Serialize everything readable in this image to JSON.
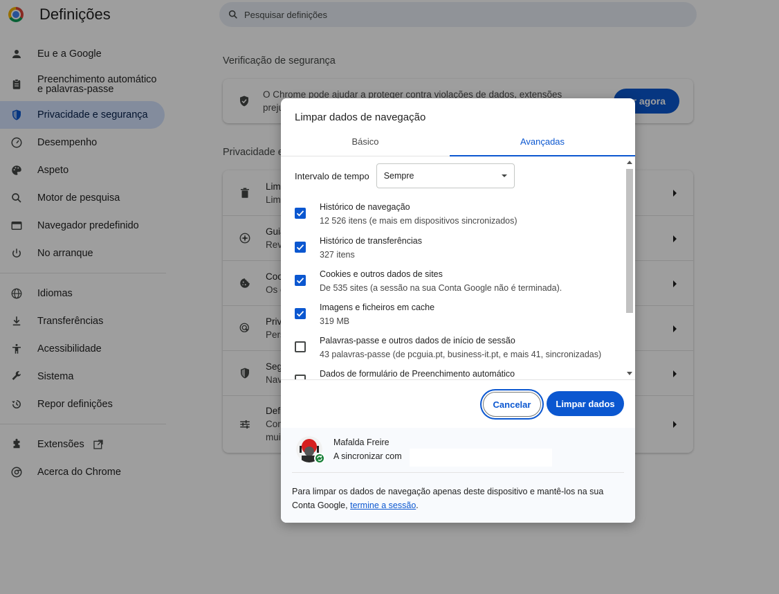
{
  "app": {
    "title": "Definições"
  },
  "search": {
    "placeholder": "Pesquisar definições"
  },
  "sidebar": {
    "items": [
      {
        "label": "Eu e a Google"
      },
      {
        "label": "Preenchimento automático e palavras-passe"
      },
      {
        "label": "Privacidade e segurança"
      },
      {
        "label": "Desempenho"
      },
      {
        "label": "Aspeto"
      },
      {
        "label": "Motor de pesquisa"
      },
      {
        "label": "Navegador predefinido"
      },
      {
        "label": "No arranque"
      },
      {
        "label": "Idiomas"
      },
      {
        "label": "Transferências"
      },
      {
        "label": "Acessibilidade"
      },
      {
        "label": "Sistema"
      },
      {
        "label": "Repor definições"
      },
      {
        "label": "Extensões"
      },
      {
        "label": "Acerca do Chrome"
      }
    ]
  },
  "main": {
    "safety_title": "Verificação de segurança",
    "safety_text": "O Chrome pode ajudar a proteger contra violações de dados, extensões prejudiciais e muit",
    "safety_button": "er agora",
    "privacy_title": "Privacidade e",
    "rows": [
      {
        "t1": "Limp",
        "t2": "Limp"
      },
      {
        "t1": "Guia",
        "t2": "Reve"
      },
      {
        "t1": "Cook",
        "t2": "Os c"
      },
      {
        "t1": "Priva",
        "t2": "Perso"
      },
      {
        "t1": "Segu",
        "t2": "Nave"
      },
      {
        "t1": "Defir",
        "t2": "Cont",
        "t3": "muit"
      }
    ]
  },
  "dialog": {
    "title": "Limpar dados de navegação",
    "tabs": {
      "basic": "Básico",
      "advanced": "Avançadas"
    },
    "time_range": {
      "label": "Intervalo de tempo",
      "value": "Sempre"
    },
    "options": [
      {
        "title": "Histórico de navegação",
        "detail": "12 526 itens (e mais em dispositivos sincronizados)",
        "checked": true
      },
      {
        "title": "Histórico de transferências",
        "detail": "327 itens",
        "checked": true
      },
      {
        "title": "Cookies e outros dados de sites",
        "detail": "De 535 sites (a sessão na sua Conta Google não é terminada).",
        "checked": true
      },
      {
        "title": "Imagens e ficheiros em cache",
        "detail": "319 MB",
        "checked": true
      },
      {
        "title": "Palavras-passe e outros dados de início de sessão",
        "detail": "43 palavras-passe (de pcguia.pt, business-it.pt, e mais 41, sincronizadas)",
        "checked": false
      },
      {
        "title": "Dados de formulário de Preenchimento automático",
        "detail": "",
        "checked": false
      }
    ],
    "buttons": {
      "cancel": "Cancelar",
      "clear": "Limpar dados"
    },
    "account": {
      "name": "Mafalda Freire",
      "sync": "A sincronizar com"
    },
    "footer": {
      "text": "Para limpar os dados de navegação apenas deste dispositivo e mantê-los na sua Conta Google,",
      "link": "termine a sessão",
      "end": "."
    }
  },
  "colors": {
    "accent": "#0b57d0",
    "active_nav": "#d3e3fd",
    "sync_badge": "#188038"
  }
}
